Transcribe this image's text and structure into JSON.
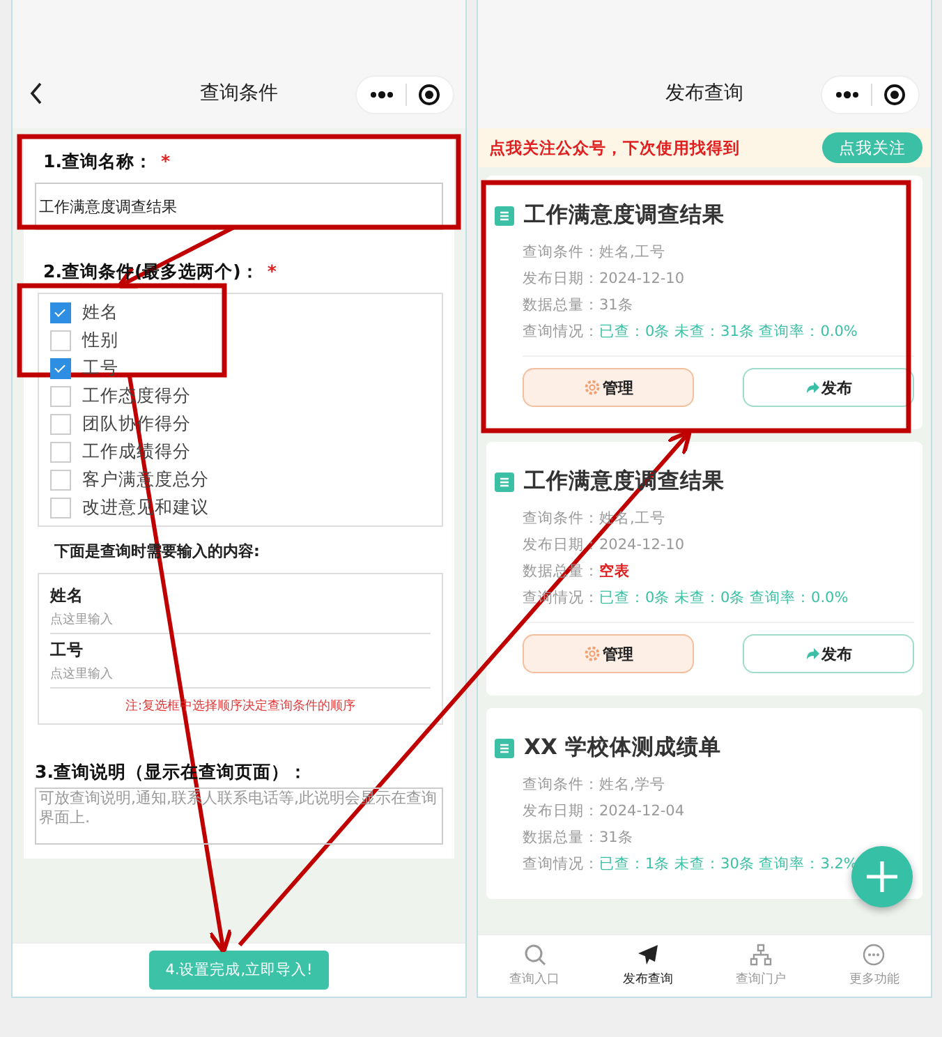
{
  "left_screen": {
    "nav": {
      "title": "查询条件"
    },
    "name_section": {
      "label": "1.查询名称：",
      "required_mark": "*",
      "value": "工作满意度调查结果"
    },
    "conditions_section": {
      "label": "2.查询条件(最多选两个)：",
      "required_mark": "*",
      "options": [
        {
          "label": "姓名",
          "checked": true
        },
        {
          "label": "性别",
          "checked": false
        },
        {
          "label": "工号",
          "checked": true
        },
        {
          "label": "工作态度得分",
          "checked": false
        },
        {
          "label": "团队协作得分",
          "checked": false
        },
        {
          "label": "工作成绩得分",
          "checked": false
        },
        {
          "label": "客户满意度总分",
          "checked": false
        },
        {
          "label": "改进意见和建议",
          "checked": false
        }
      ]
    },
    "input_preview": {
      "heading": "下面是查询时需要输入的内容:",
      "fields": [
        {
          "label": "姓名",
          "placeholder": "点这里输入"
        },
        {
          "label": "工号",
          "placeholder": "点这里输入"
        }
      ],
      "note": "注:复选框中选择顺序决定查询条件的顺序"
    },
    "description_section": {
      "label": "3.查询说明（显示在查询页面）：",
      "placeholder": "可放查询说明,通知,联系人联系电话等,此说明会显示在查询界面上."
    },
    "submit_button": "4.设置完成,立即导入!"
  },
  "right_screen": {
    "nav": {
      "title": "发布查询"
    },
    "banner": {
      "text": "点我关注公众号，下次使用找得到",
      "button": "点我关注"
    },
    "cards": [
      {
        "title": "工作满意度调查结果",
        "rows": [
          {
            "label": "查询条件：",
            "value": "姓名,工号",
            "kind": "plain"
          },
          {
            "label": "发布日期：",
            "value": "2024-12-10",
            "kind": "plain"
          },
          {
            "label": "数据总量：",
            "value": "31条",
            "kind": "plain"
          },
          {
            "label": "查询情况：",
            "value": "已查：0条 未查：31条 查询率：0.0%",
            "kind": "stats"
          }
        ],
        "actions": [
          {
            "label": "管理",
            "kind": "manage"
          },
          {
            "label": "发布",
            "kind": "publish"
          }
        ]
      },
      {
        "title": "工作满意度调查结果",
        "rows": [
          {
            "label": "查询条件：",
            "value": "姓名,工号",
            "kind": "plain"
          },
          {
            "label": "发布日期：",
            "value": "2024-12-10",
            "kind": "plain"
          },
          {
            "label": "数据总量：",
            "value": "空表",
            "kind": "alert"
          },
          {
            "label": "查询情况：",
            "value": "已查：0条 未查：0条 查询率：0.0%",
            "kind": "stats"
          }
        ],
        "actions": [
          {
            "label": "管理",
            "kind": "manage"
          },
          {
            "label": "发布",
            "kind": "publish"
          }
        ]
      },
      {
        "title": "XX 学校体测成绩单",
        "rows": [
          {
            "label": "查询条件：",
            "value": "姓名,学号",
            "kind": "plain"
          },
          {
            "label": "发布日期：",
            "value": "2024-12-04",
            "kind": "plain"
          },
          {
            "label": "数据总量：",
            "value": "31条",
            "kind": "plain"
          },
          {
            "label": "查询情况：",
            "value": "已查：1条 未查：30条 查询率：3.2%",
            "kind": "stats"
          }
        ]
      }
    ],
    "tabs": [
      {
        "label": "查询入口",
        "selected": false
      },
      {
        "label": "发布查询",
        "selected": true
      },
      {
        "label": "查询门户",
        "selected": false
      },
      {
        "label": "更多功能",
        "selected": false
      }
    ]
  }
}
